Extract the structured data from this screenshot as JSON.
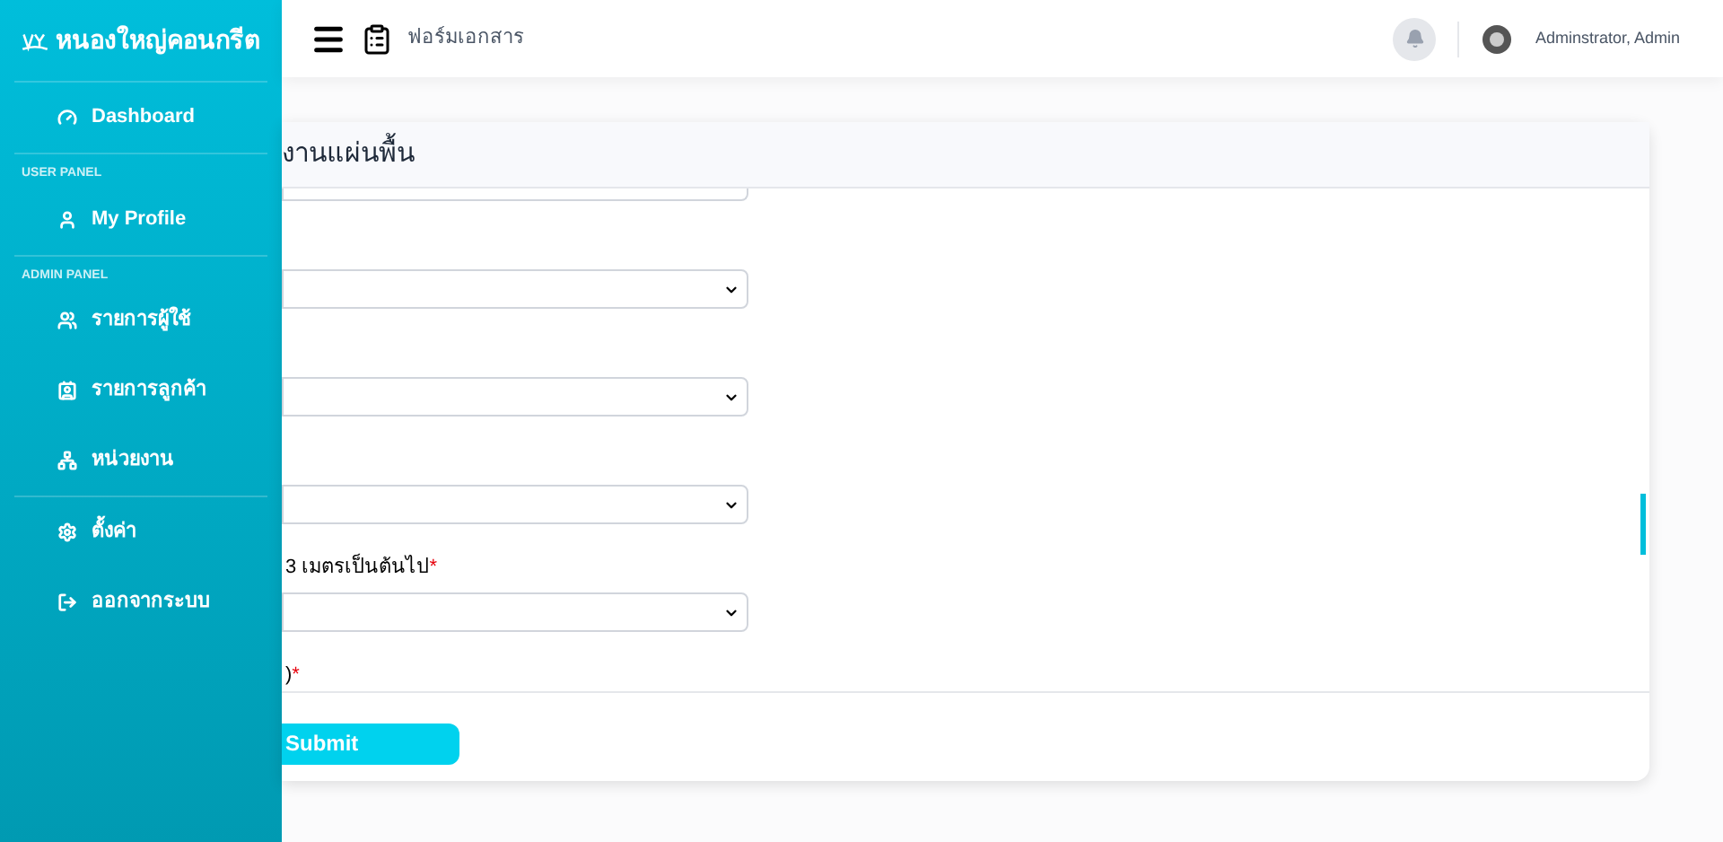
{
  "sidebar": {
    "brand": "หนองใหญ่คอนกรีต",
    "sections": [
      {
        "items": [
          {
            "label": "Dashboard"
          }
        ]
      },
      {
        "heading": "USER PANEL",
        "items": [
          {
            "label": "My Profile"
          }
        ]
      },
      {
        "heading": "ADMIN PANEL",
        "items": [
          {
            "label": "รายการผู้ใช้"
          },
          {
            "label": "รายการลูกค้า"
          },
          {
            "label": "หน่วยงาน"
          }
        ]
      },
      {
        "items": [
          {
            "label": "ตั้งค่า"
          },
          {
            "label": "ออกจากระบบ"
          }
        ]
      }
    ]
  },
  "header": {
    "page_title": "ฟอร์มเอกสาร",
    "user": "Adminstrator, Admin"
  },
  "card": {
    "title": "งานแผ่นพื้น",
    "form_items": [
      {
        "kind": "partial_select"
      },
      {
        "kind": "select"
      },
      {
        "kind": "select"
      },
      {
        "kind": "select"
      },
      {
        "kind": "label",
        "text": "3 เมตรเป็นต้นไป",
        "required_mark": "*"
      },
      {
        "kind": "select"
      },
      {
        "kind": "label",
        "text": ")",
        "required_mark": "*"
      }
    ],
    "submit": "Submit"
  }
}
